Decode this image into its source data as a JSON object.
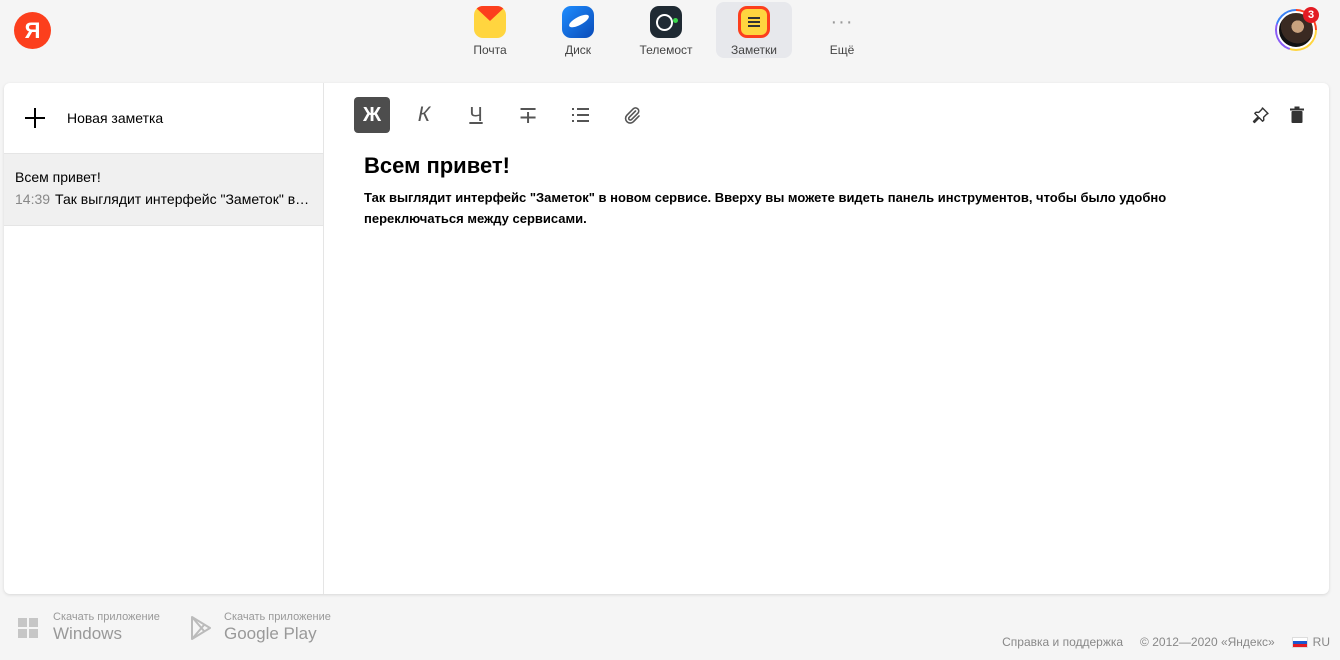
{
  "header": {
    "logo_letter": "Я",
    "services": [
      {
        "label": "Почта",
        "icon": "mail-icon",
        "active": false
      },
      {
        "label": "Диск",
        "icon": "disk-icon",
        "active": false
      },
      {
        "label": "Телемост",
        "icon": "telemost-icon",
        "active": false
      },
      {
        "label": "Заметки",
        "icon": "notes-icon",
        "active": true
      },
      {
        "label": "Ещё",
        "icon": "more-dots-icon",
        "active": false
      }
    ],
    "more_glyph": "···",
    "notifications_count": "3"
  },
  "sidebar": {
    "new_note_label": "Новая заметка",
    "notes": [
      {
        "title": "Всем привет!",
        "time": "14:39",
        "preview": "Так выглядит интерфейс \"Заметок\" в новом сервисе."
      }
    ]
  },
  "toolbar": {
    "bold": "Ж",
    "italic": "К",
    "underline": "Ч",
    "strike": "∓"
  },
  "editor": {
    "title": "Всем привет!",
    "body": "Так выглядит интерфейс \"Заметок\" в новом сервисе. Вверху вы можете видеть панель инструментов, чтобы было удобно переключаться между сервисами."
  },
  "footer": {
    "apps": [
      {
        "small": "Скачать приложение",
        "big": "Windows"
      },
      {
        "small": "Скачать приложение",
        "big": "Google Play"
      }
    ],
    "support": "Справка и поддержка",
    "copyright": "© 2012—2020 «Яндекс»",
    "lang": "RU"
  },
  "colors": {
    "brand_red": "#fc3f1d",
    "brand_yellow": "#ffd53f",
    "active_tool": "#4d4d4d"
  }
}
